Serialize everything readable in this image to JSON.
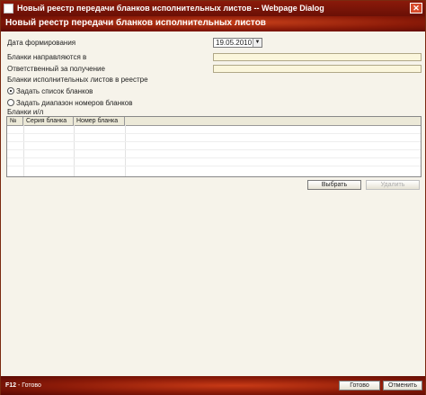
{
  "window": {
    "title": "Новый реестр передачи бланков исполнительных листов -- Webpage Dialog",
    "close_glyph": "✕"
  },
  "header": {
    "title": "Новый реестр передачи бланков исполнительных листов"
  },
  "form": {
    "date_label": "Дата формирования",
    "date_value": "19.05.2010",
    "date_dropdown_glyph": "▼",
    "sent_to_label": "Бланки направляются в",
    "sent_to_value": "",
    "responsible_label": "Ответственный за получение",
    "responsible_value": "",
    "registry_label": "Бланки исполнительных листов в реестре",
    "radio_list_label": "Задать список бланков",
    "radio_list_selected": true,
    "radio_range_label": "Задать диапазон номеров бланков",
    "radio_range_selected": false,
    "blanks_label": "Бланки и/л"
  },
  "table": {
    "columns": [
      "№",
      "Серия бланка",
      "Номер бланка",
      ""
    ],
    "rows": []
  },
  "actions": {
    "select_label": "Выбрать",
    "delete_label": "Удалить"
  },
  "footer": {
    "hint_key": "F12",
    "hint_text": " - Готово",
    "done_label": "Готово",
    "cancel_label": "Отменить"
  }
}
